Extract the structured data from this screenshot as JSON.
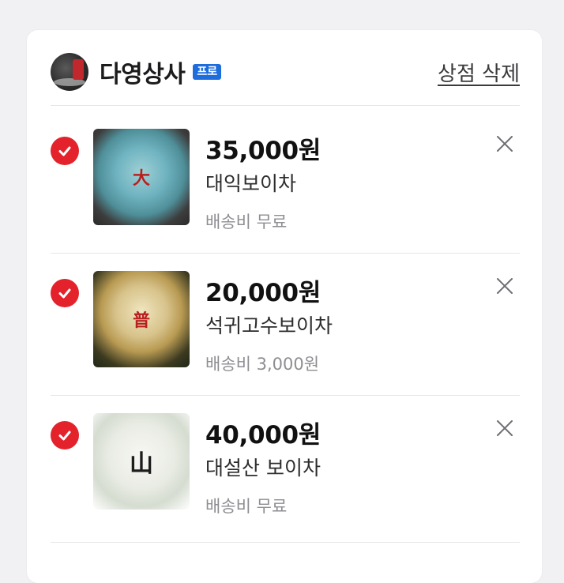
{
  "shop": {
    "name": "다영상사",
    "badge": "프로",
    "delete_label": "상점 삭제"
  },
  "items": [
    {
      "price": "35,000원",
      "title": "대익보이차",
      "shipping": "배송비 무료",
      "checked": true
    },
    {
      "price": "20,000원",
      "title": "석귀고수보이차",
      "shipping": "배송비 3,000원",
      "checked": true
    },
    {
      "price": "40,000원",
      "title": "대설산 보이차",
      "shipping": "배송비 무료",
      "checked": true
    }
  ],
  "colors": {
    "check": "#e3222b",
    "badge": "#1e6ddc",
    "background": "#f1f1f3"
  }
}
